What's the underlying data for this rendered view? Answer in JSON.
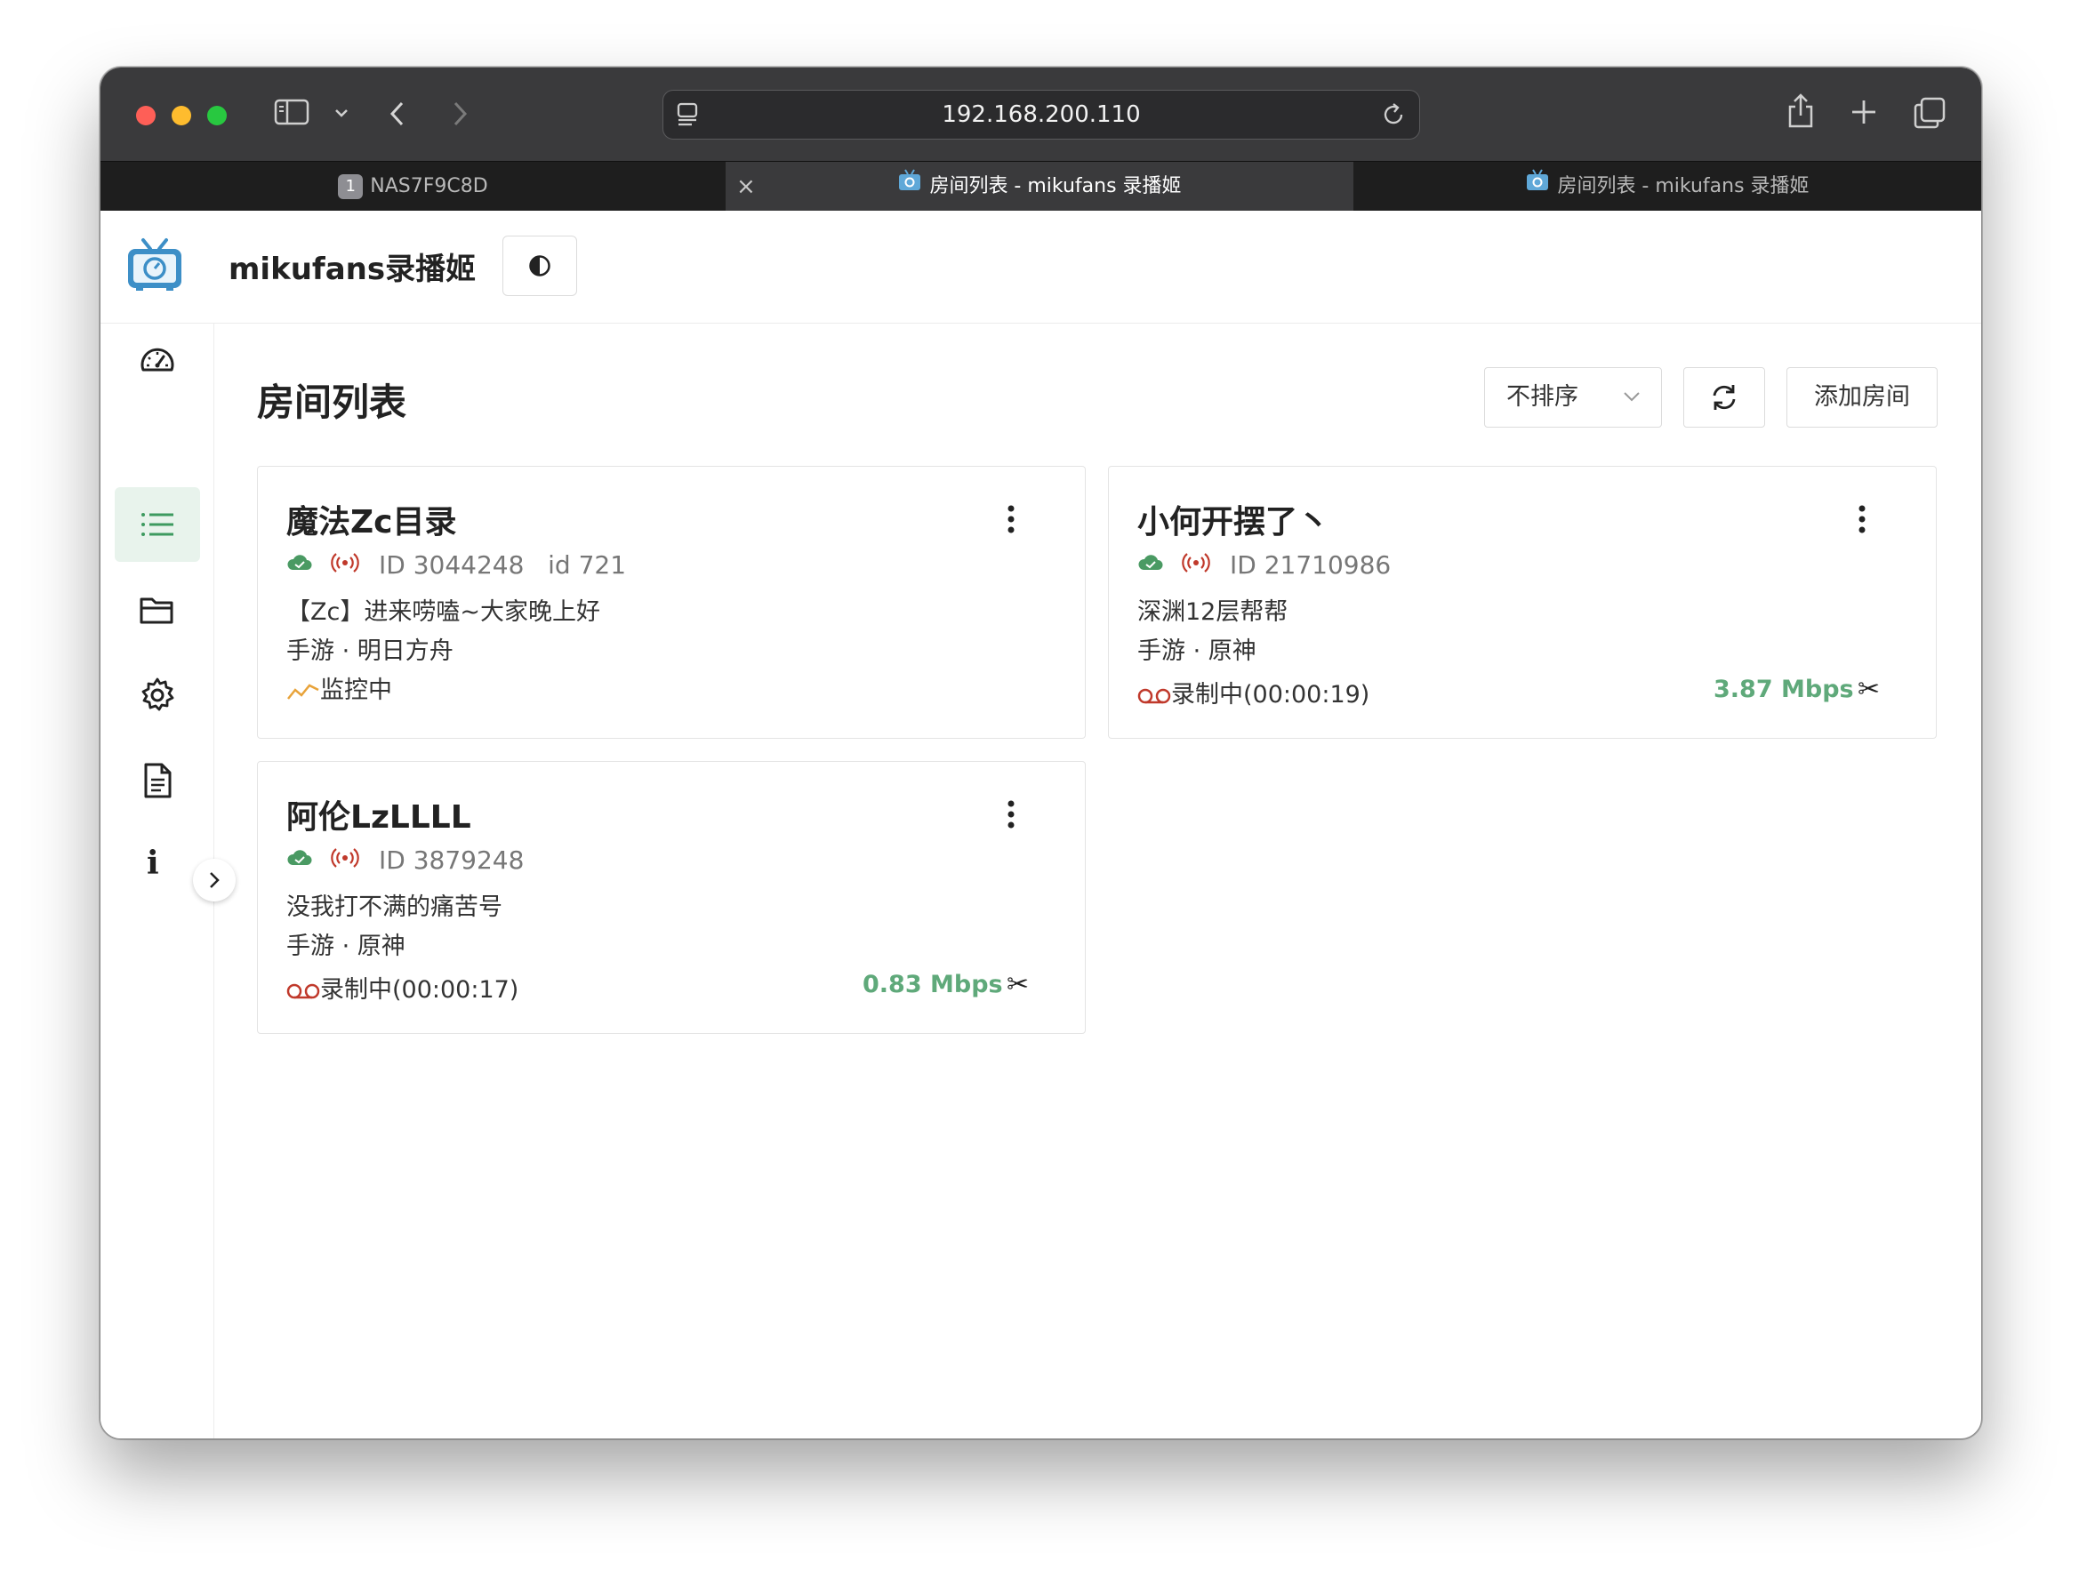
{
  "browser": {
    "url": "192.168.200.110",
    "tabs": [
      {
        "badge": "1",
        "label": "NAS7F9C8D",
        "active": false
      },
      {
        "label": "房间列表 - mikufans 录播姬",
        "active": true,
        "close": "×"
      },
      {
        "label": "房间列表 - mikufans 录播姬",
        "active": false
      }
    ]
  },
  "app": {
    "name": "mikufans录播姬",
    "theme_icon": "contrast-icon"
  },
  "sidebar": {
    "items": [
      {
        "icon": "dashboard-icon"
      },
      {
        "icon": "list-icon",
        "active": true
      },
      {
        "icon": "folder-icon"
      },
      {
        "icon": "settings-icon"
      },
      {
        "icon": "document-icon"
      },
      {
        "icon": "info-icon",
        "text": "i"
      }
    ]
  },
  "main": {
    "title": "房间列表",
    "sort_label": "不排序",
    "refresh_icon": "refresh-icon",
    "add_room": "添加房间"
  },
  "rooms": [
    {
      "name": "魔法Zc目录",
      "id_text": "ID 3044248   id 721",
      "title": "【Zc】进来唠嗑~大家晚上好",
      "category": "手游 · 明日方舟",
      "status": "监控中",
      "status_type": "monitoring"
    },
    {
      "name": "小何开摆了丶",
      "id_text": "ID 21710986",
      "title": "深渊12层帮帮",
      "category": "手游 · 原神",
      "status": "录制中(00:00:19)",
      "status_type": "recording",
      "rate": "3.87 Mbps",
      "cut": "✂"
    },
    {
      "name": "阿伦LzLLLL",
      "id_text": "ID 3879248",
      "title": "没我打不满的痛苦号",
      "category": "手游 · 原神",
      "status": "录制中(00:00:17)",
      "status_type": "recording",
      "rate": "0.83 Mbps",
      "cut": "✂"
    }
  ],
  "colors": {
    "accent_green": "#5fa97a",
    "cloud_green": "#4a9a63",
    "live_red": "#c0392b",
    "monitor_orange": "#e8a33a"
  }
}
